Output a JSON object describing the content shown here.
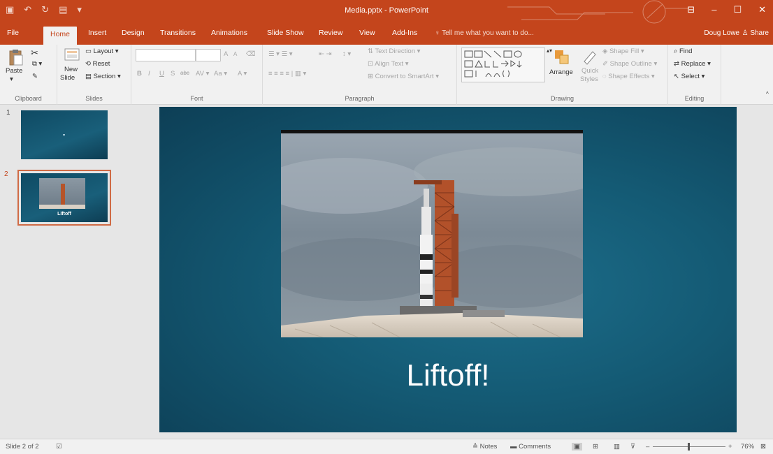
{
  "window": {
    "title": "Media.pptx - PowerPoint",
    "user": "Doug Lowe",
    "share_label": "Share",
    "minimize": "–",
    "restore": "☐",
    "close": "✕",
    "ribbon_display": "⊟"
  },
  "tabs": [
    "File",
    "Home",
    "Insert",
    "Design",
    "Transitions",
    "Animations",
    "Slide Show",
    "Review",
    "View",
    "Add-Ins"
  ],
  "active_tab": "Home",
  "tell_me": "Tell me what you want to do...",
  "ribbon": {
    "clipboard": {
      "label": "Clipboard",
      "paste": "Paste"
    },
    "slides": {
      "label": "Slides",
      "new_slide": "New",
      "new_slide_2": "Slide",
      "layout": "Layout",
      "reset": "Reset",
      "section": "Section"
    },
    "font": {
      "label": "Font",
      "bold": "B",
      "italic": "I",
      "underline": "U",
      "shadow": "S",
      "strike": "abc",
      "size_up": "A",
      "size_down": "A",
      "change_case": "Aa",
      "font_color": "A"
    },
    "paragraph": {
      "label": "Paragraph",
      "text_direction": "Text Direction",
      "align_text": "Align Text",
      "convert_smartart": "Convert to SmartArt"
    },
    "drawing": {
      "label": "Drawing",
      "arrange": "Arrange",
      "quick_styles": "Quick",
      "quick_styles_2": "Styles",
      "shape_fill": "Shape Fill",
      "shape_outline": "Shape Outline",
      "shape_effects": "Shape Effects"
    },
    "editing": {
      "label": "Editing",
      "find": "Find",
      "replace": "Replace",
      "select": "Select"
    }
  },
  "thumbnails": [
    {
      "number": "1",
      "caption": ""
    },
    {
      "number": "2",
      "caption": "Liftoff"
    }
  ],
  "slide": {
    "title": "Liftoff!"
  },
  "status": {
    "slide_info": "Slide 2 of 2",
    "notes": "Notes",
    "comments": "Comments",
    "zoom": "76%"
  },
  "colors": {
    "accent": "#c4451c",
    "slide_bg": "#145a74"
  }
}
